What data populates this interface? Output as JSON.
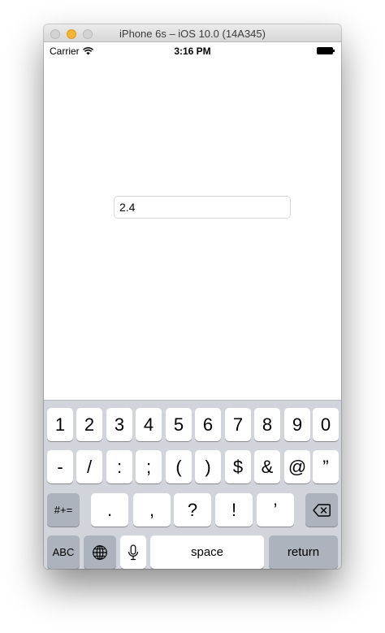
{
  "window": {
    "title": "iPhone 6s – iOS 10.0 (14A345)"
  },
  "status_bar": {
    "carrier": "Carrier",
    "time": "3:16 PM"
  },
  "text_field": {
    "value": "2.4"
  },
  "keyboard": {
    "row1": [
      "1",
      "2",
      "3",
      "4",
      "5",
      "6",
      "7",
      "8",
      "9",
      "0"
    ],
    "row2": [
      "-",
      "/",
      ":",
      ";",
      "(",
      ")",
      "$",
      "&",
      "@",
      "”"
    ],
    "row3": {
      "toggle": "#+=",
      "keys": [
        ".",
        ",",
        "?",
        "!",
        "’"
      ]
    },
    "row4": {
      "abc": "ABC",
      "space": "space",
      "return": "return"
    }
  },
  "colors": {
    "keyboard_bg": "#d1d4da",
    "key_bg": "#ffffff",
    "special_key_bg": "#acb3bc",
    "minimize_button": "#f6b32f"
  }
}
